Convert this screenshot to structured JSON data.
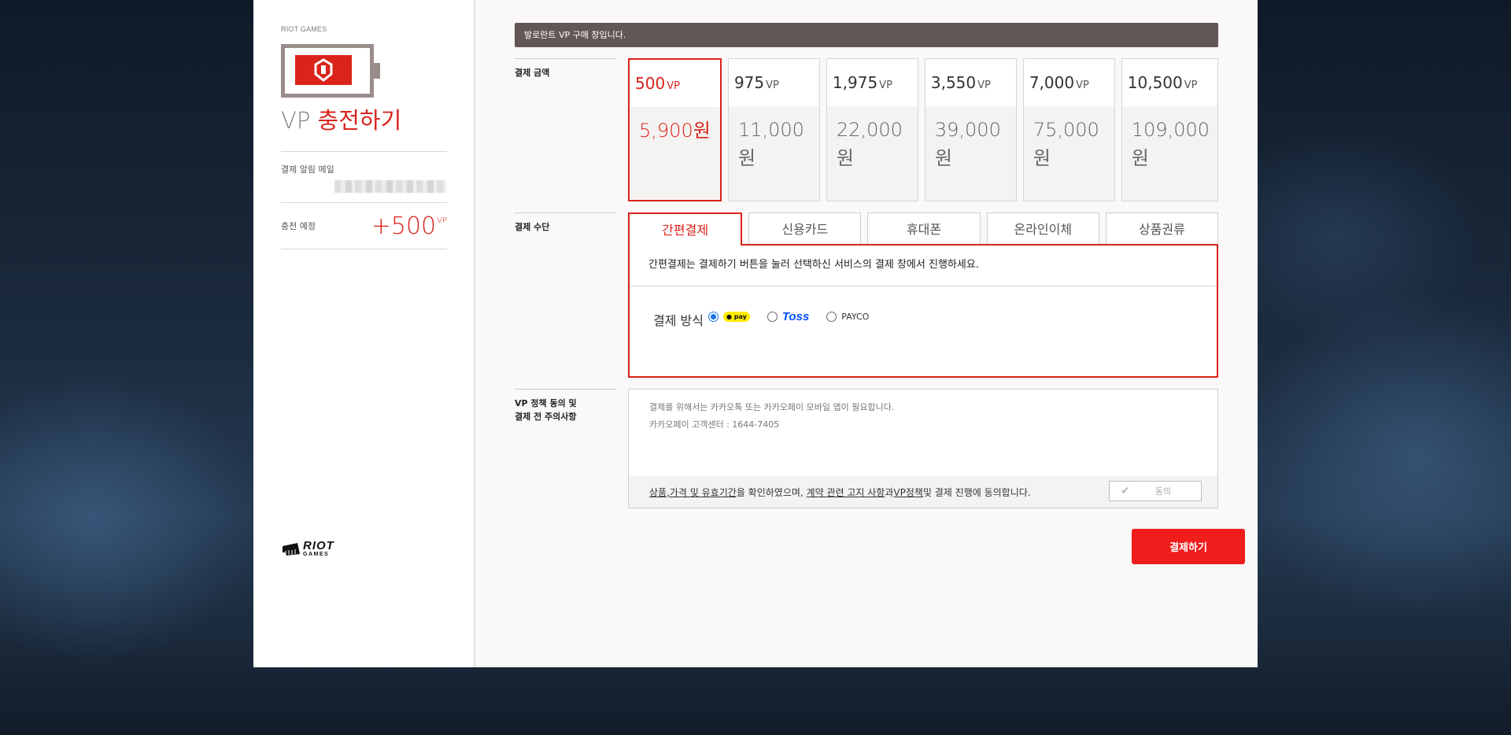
{
  "sidebar": {
    "brand_small": "RIOT GAMES",
    "title_prefix": "VP ",
    "title_highlight": "충전하기",
    "email_label": "결제 알림 메일",
    "charge_label": "충전 예정",
    "charge_value": "+500",
    "charge_unit": "VP",
    "logo_text_top": "RIOT",
    "logo_text_bottom": "GAMES"
  },
  "main": {
    "notice": "발로란트 VP 구매 창입니다.",
    "amount_label": "결제 금액",
    "products": [
      {
        "vp": "500",
        "unit": "VP",
        "price": "5,900원",
        "selected": true
      },
      {
        "vp": "975",
        "unit": "VP",
        "price": "11,000원",
        "selected": false
      },
      {
        "vp": "1,975",
        "unit": "VP",
        "price": "22,000원",
        "selected": false
      },
      {
        "vp": "3,550",
        "unit": "VP",
        "price": "39,000원",
        "selected": false
      },
      {
        "vp": "7,000",
        "unit": "VP",
        "price": "75,000원",
        "selected": false
      },
      {
        "vp": "10,500",
        "unit": "VP",
        "price": "109,000원",
        "selected": false
      }
    ],
    "method_label": "결제 수단",
    "tabs": [
      "간편결제",
      "신용카드",
      "휴대폰",
      "온라인이체",
      "상품권류"
    ],
    "active_tab": 0,
    "pay_desc": "간편결제는 결제하기 버튼을 눌러 선택하신 서비스의 결제 창에서 진행하세요.",
    "pay_method_label": "결제 방식",
    "pay_methods": [
      "pay",
      "Toss",
      "PAYCO"
    ],
    "policy_label_1": "VP 정책 동의 및",
    "policy_label_2": "결제 전 주의사항",
    "policy_line_1": "결제를 위해서는 카카오톡 또는 카카오페이 모바일 앱이 필요합니다.",
    "policy_line_2": "카카오페이 고객센터 : 1644-7405",
    "agree_link_1": "상품,가격 및 유효기간",
    "agree_text_1": "을 확인하였으며, ",
    "agree_link_2": "계약 관련 고지 사항",
    "agree_text_2": "과 ",
    "agree_link_3": "VP정책",
    "agree_text_3": " 및 결제 진행에 동의합니다.",
    "agree_button": "동의",
    "pay_button": "결제하기"
  },
  "colors": {
    "accent": "#d9231b",
    "notice_bg": "#635656",
    "pay_button": "#f01d1d"
  }
}
